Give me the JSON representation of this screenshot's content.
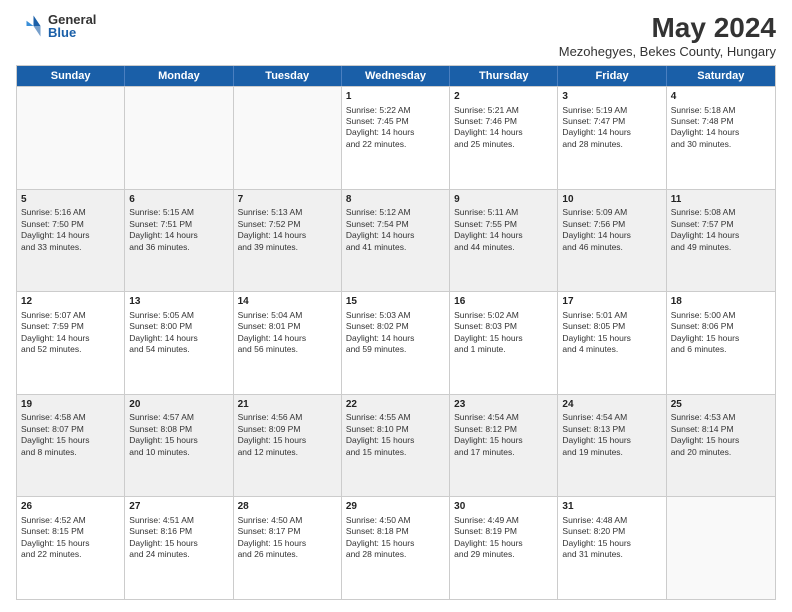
{
  "logo": {
    "general": "General",
    "blue": "Blue"
  },
  "title": "May 2024",
  "subtitle": "Mezohegyes, Bekes County, Hungary",
  "header_days": [
    "Sunday",
    "Monday",
    "Tuesday",
    "Wednesday",
    "Thursday",
    "Friday",
    "Saturday"
  ],
  "rows": [
    [
      {
        "day": "",
        "empty": true
      },
      {
        "day": "",
        "empty": true
      },
      {
        "day": "",
        "empty": true
      },
      {
        "day": "1",
        "lines": [
          "Sunrise: 5:22 AM",
          "Sunset: 7:45 PM",
          "Daylight: 14 hours",
          "and 22 minutes."
        ]
      },
      {
        "day": "2",
        "lines": [
          "Sunrise: 5:21 AM",
          "Sunset: 7:46 PM",
          "Daylight: 14 hours",
          "and 25 minutes."
        ]
      },
      {
        "day": "3",
        "lines": [
          "Sunrise: 5:19 AM",
          "Sunset: 7:47 PM",
          "Daylight: 14 hours",
          "and 28 minutes."
        ]
      },
      {
        "day": "4",
        "lines": [
          "Sunrise: 5:18 AM",
          "Sunset: 7:48 PM",
          "Daylight: 14 hours",
          "and 30 minutes."
        ]
      }
    ],
    [
      {
        "day": "5",
        "lines": [
          "Sunrise: 5:16 AM",
          "Sunset: 7:50 PM",
          "Daylight: 14 hours",
          "and 33 minutes."
        ]
      },
      {
        "day": "6",
        "lines": [
          "Sunrise: 5:15 AM",
          "Sunset: 7:51 PM",
          "Daylight: 14 hours",
          "and 36 minutes."
        ]
      },
      {
        "day": "7",
        "lines": [
          "Sunrise: 5:13 AM",
          "Sunset: 7:52 PM",
          "Daylight: 14 hours",
          "and 39 minutes."
        ]
      },
      {
        "day": "8",
        "lines": [
          "Sunrise: 5:12 AM",
          "Sunset: 7:54 PM",
          "Daylight: 14 hours",
          "and 41 minutes."
        ]
      },
      {
        "day": "9",
        "lines": [
          "Sunrise: 5:11 AM",
          "Sunset: 7:55 PM",
          "Daylight: 14 hours",
          "and 44 minutes."
        ]
      },
      {
        "day": "10",
        "lines": [
          "Sunrise: 5:09 AM",
          "Sunset: 7:56 PM",
          "Daylight: 14 hours",
          "and 46 minutes."
        ]
      },
      {
        "day": "11",
        "lines": [
          "Sunrise: 5:08 AM",
          "Sunset: 7:57 PM",
          "Daylight: 14 hours",
          "and 49 minutes."
        ]
      }
    ],
    [
      {
        "day": "12",
        "lines": [
          "Sunrise: 5:07 AM",
          "Sunset: 7:59 PM",
          "Daylight: 14 hours",
          "and 52 minutes."
        ]
      },
      {
        "day": "13",
        "lines": [
          "Sunrise: 5:05 AM",
          "Sunset: 8:00 PM",
          "Daylight: 14 hours",
          "and 54 minutes."
        ]
      },
      {
        "day": "14",
        "lines": [
          "Sunrise: 5:04 AM",
          "Sunset: 8:01 PM",
          "Daylight: 14 hours",
          "and 56 minutes."
        ]
      },
      {
        "day": "15",
        "lines": [
          "Sunrise: 5:03 AM",
          "Sunset: 8:02 PM",
          "Daylight: 14 hours",
          "and 59 minutes."
        ]
      },
      {
        "day": "16",
        "lines": [
          "Sunrise: 5:02 AM",
          "Sunset: 8:03 PM",
          "Daylight: 15 hours",
          "and 1 minute."
        ]
      },
      {
        "day": "17",
        "lines": [
          "Sunrise: 5:01 AM",
          "Sunset: 8:05 PM",
          "Daylight: 15 hours",
          "and 4 minutes."
        ]
      },
      {
        "day": "18",
        "lines": [
          "Sunrise: 5:00 AM",
          "Sunset: 8:06 PM",
          "Daylight: 15 hours",
          "and 6 minutes."
        ]
      }
    ],
    [
      {
        "day": "19",
        "lines": [
          "Sunrise: 4:58 AM",
          "Sunset: 8:07 PM",
          "Daylight: 15 hours",
          "and 8 minutes."
        ]
      },
      {
        "day": "20",
        "lines": [
          "Sunrise: 4:57 AM",
          "Sunset: 8:08 PM",
          "Daylight: 15 hours",
          "and 10 minutes."
        ]
      },
      {
        "day": "21",
        "lines": [
          "Sunrise: 4:56 AM",
          "Sunset: 8:09 PM",
          "Daylight: 15 hours",
          "and 12 minutes."
        ]
      },
      {
        "day": "22",
        "lines": [
          "Sunrise: 4:55 AM",
          "Sunset: 8:10 PM",
          "Daylight: 15 hours",
          "and 15 minutes."
        ]
      },
      {
        "day": "23",
        "lines": [
          "Sunrise: 4:54 AM",
          "Sunset: 8:12 PM",
          "Daylight: 15 hours",
          "and 17 minutes."
        ]
      },
      {
        "day": "24",
        "lines": [
          "Sunrise: 4:54 AM",
          "Sunset: 8:13 PM",
          "Daylight: 15 hours",
          "and 19 minutes."
        ]
      },
      {
        "day": "25",
        "lines": [
          "Sunrise: 4:53 AM",
          "Sunset: 8:14 PM",
          "Daylight: 15 hours",
          "and 20 minutes."
        ]
      }
    ],
    [
      {
        "day": "26",
        "lines": [
          "Sunrise: 4:52 AM",
          "Sunset: 8:15 PM",
          "Daylight: 15 hours",
          "and 22 minutes."
        ]
      },
      {
        "day": "27",
        "lines": [
          "Sunrise: 4:51 AM",
          "Sunset: 8:16 PM",
          "Daylight: 15 hours",
          "and 24 minutes."
        ]
      },
      {
        "day": "28",
        "lines": [
          "Sunrise: 4:50 AM",
          "Sunset: 8:17 PM",
          "Daylight: 15 hours",
          "and 26 minutes."
        ]
      },
      {
        "day": "29",
        "lines": [
          "Sunrise: 4:50 AM",
          "Sunset: 8:18 PM",
          "Daylight: 15 hours",
          "and 28 minutes."
        ]
      },
      {
        "day": "30",
        "lines": [
          "Sunrise: 4:49 AM",
          "Sunset: 8:19 PM",
          "Daylight: 15 hours",
          "and 29 minutes."
        ]
      },
      {
        "day": "31",
        "lines": [
          "Sunrise: 4:48 AM",
          "Sunset: 8:20 PM",
          "Daylight: 15 hours",
          "and 31 minutes."
        ]
      },
      {
        "day": "",
        "empty": true
      }
    ]
  ]
}
